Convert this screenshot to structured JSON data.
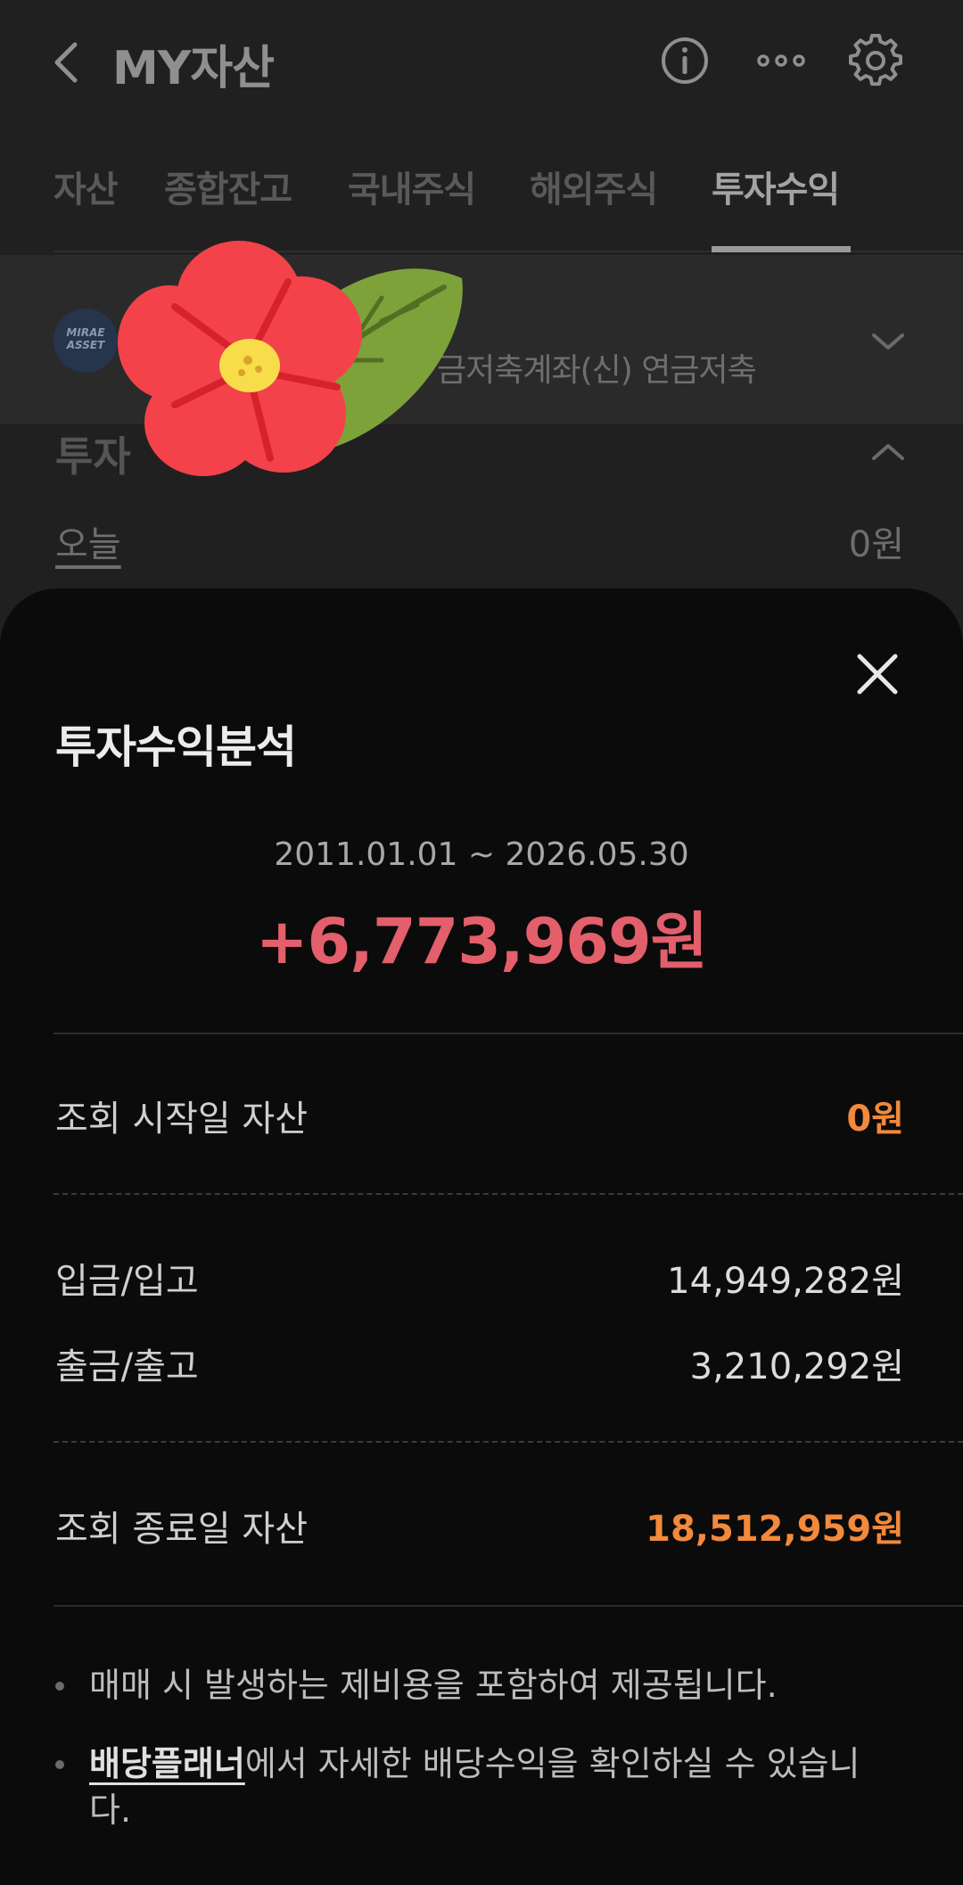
{
  "header": {
    "title": "MY자산",
    "icons": [
      "chevron-left-icon",
      "info-icon",
      "more-horizontal-icon",
      "gear-icon"
    ]
  },
  "tabs": [
    {
      "label": "자산",
      "active": false
    },
    {
      "label": "종합잔고",
      "active": false
    },
    {
      "label": "국내주식",
      "active": false
    },
    {
      "label": "해외주식",
      "active": false
    },
    {
      "label": "투자수익",
      "active": true
    }
  ],
  "account": {
    "logo_line1": "MIRAE",
    "logo_line2": "ASSET",
    "name": "금저축계좌(신) 연금저축"
  },
  "section": {
    "title": "투자",
    "today_label": "오늘",
    "today_value": "0원"
  },
  "sheet": {
    "title": "투자수익분석",
    "period": "2011.01.01 ~ 2026.05.30",
    "total": "+6,773,969원",
    "rows": {
      "start_label": "조회 시작일 자산",
      "start_value": "0원",
      "deposit_label": "입금/입고",
      "deposit_value": "14,949,282원",
      "withdraw_label": "출금/출고",
      "withdraw_value": "3,210,292원",
      "end_label": "조회 종료일 자산",
      "end_value": "18,512,959원"
    },
    "notes": {
      "note1": "매매 시 발생하는 제비용을 포함하여 제공됩니다.",
      "note2_link": "배당플래너",
      "note2_rest": "에서 자세한 배당수익을 확인하실 수 있습니다."
    }
  },
  "colors": {
    "profit": "#e35f6b",
    "highlight": "#f2893c",
    "sheet_bg": "#0b0b0b",
    "page_bg": "#202020"
  }
}
